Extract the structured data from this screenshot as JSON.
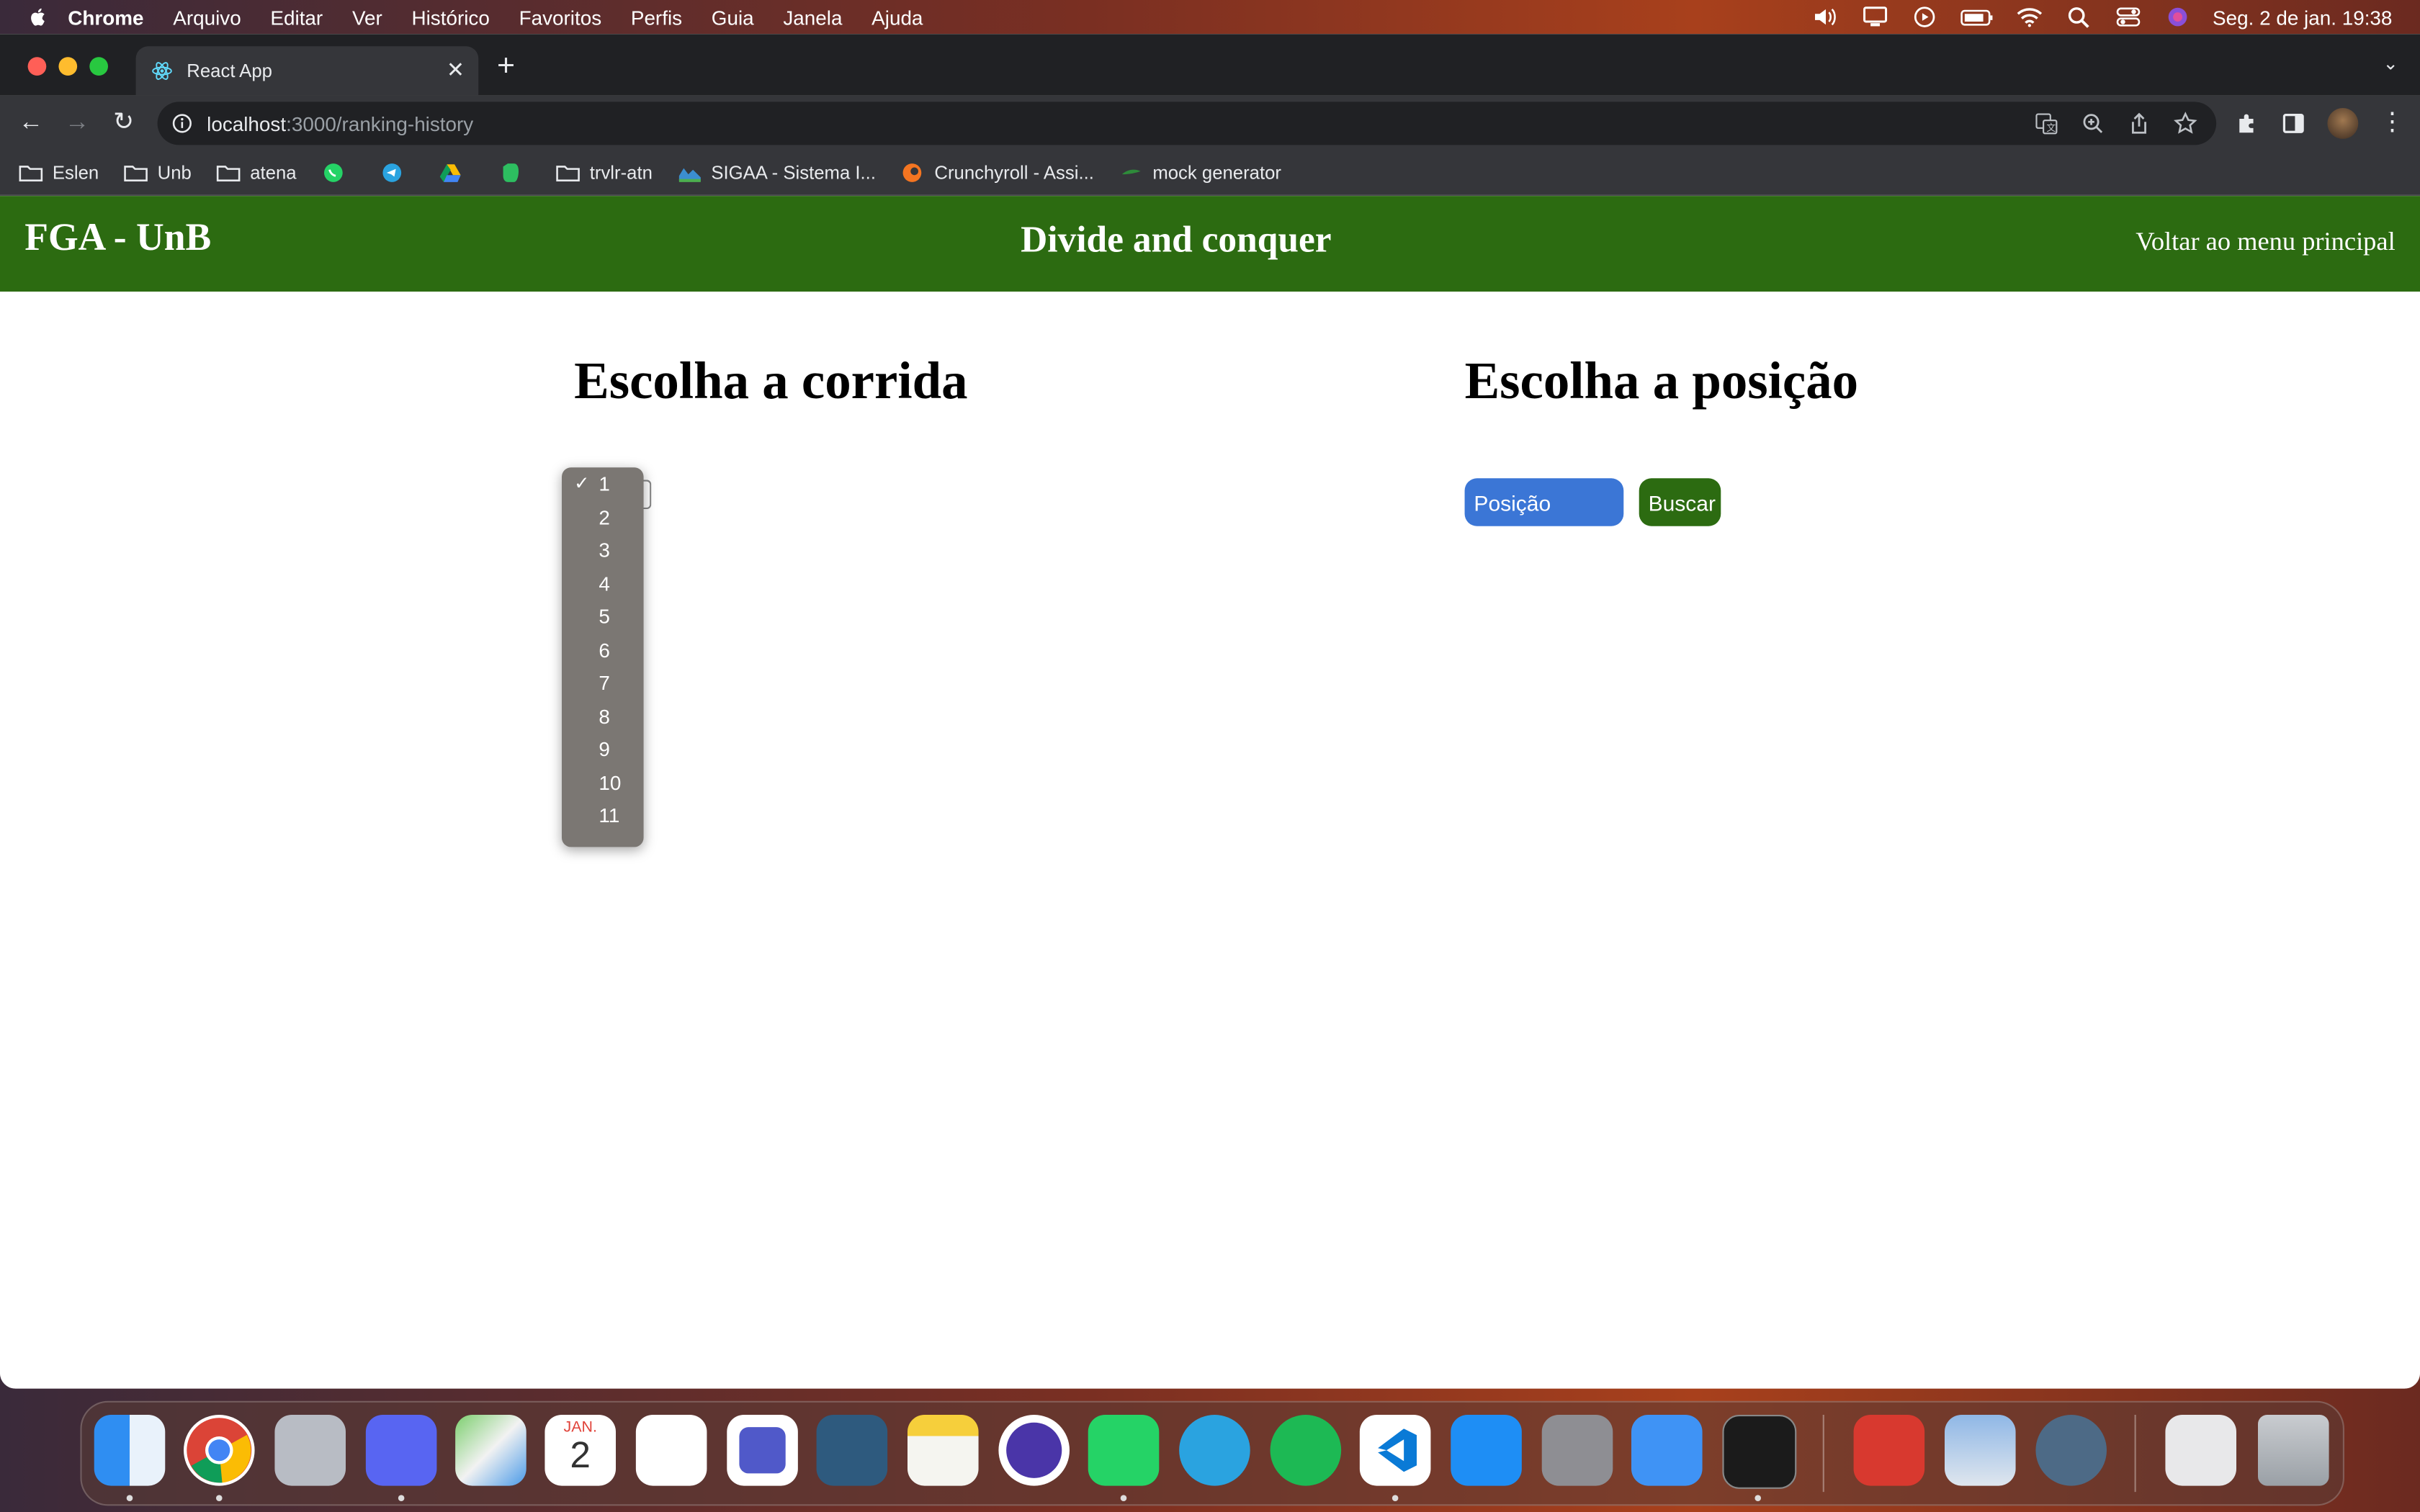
{
  "menubar": {
    "app": "Chrome",
    "items": [
      "Arquivo",
      "Editar",
      "Ver",
      "Histórico",
      "Favoritos",
      "Perfis",
      "Guia",
      "Janela",
      "Ajuda"
    ],
    "clock": "Seg. 2 de jan.  19:38"
  },
  "browser": {
    "tab_title": "React App",
    "url_host": "localhost",
    "url_path": ":3000/ranking-history",
    "bookmarks": [
      {
        "label": "Eslen",
        "icon": "folder-icon"
      },
      {
        "label": "Unb",
        "icon": "folder-icon"
      },
      {
        "label": "atena",
        "icon": "folder-icon"
      },
      {
        "label": "",
        "icon": "whatsapp-icon"
      },
      {
        "label": "",
        "icon": "telegram-icon"
      },
      {
        "label": "",
        "icon": "drive-icon"
      },
      {
        "label": "",
        "icon": "evernote-icon"
      },
      {
        "label": "trvlr-atn",
        "icon": "folder-icon"
      },
      {
        "label": "SIGAA - Sistema I...",
        "icon": "sigaa-icon"
      },
      {
        "label": "Crunchyroll - Assi...",
        "icon": "crunchyroll-icon"
      },
      {
        "label": "mock generator",
        "icon": "leaf-icon"
      }
    ]
  },
  "app": {
    "brand": "FGA - UnB",
    "title": "Divide and conquer",
    "back_link": "Voltar ao menu principal",
    "race_section_title": "Escolha a corrida",
    "race_options": [
      "1",
      "2",
      "3",
      "4",
      "5",
      "6",
      "7",
      "8",
      "9",
      "10",
      "11"
    ],
    "race_selected": "1",
    "position_section_title": "Escolha a posição",
    "position_placeholder": "Posição",
    "search_button": "Buscar"
  },
  "colors": {
    "header_green": "#2c6b11",
    "input_blue": "#3b76d6",
    "dropdown_bg": "#7b7773"
  },
  "dock": [
    "finder-icon",
    "chrome-icon",
    "launchpad-icon",
    "discord-icon",
    "maps-icon",
    "calendar-icon",
    "reminders-icon",
    "teams-icon",
    "mysql-workbench-icon",
    "notes-icon",
    "eclipse-icon",
    "whatsapp-icon",
    "telegram-icon",
    "spotify-icon",
    "vscode-icon",
    "app-store-icon",
    "system-preferences-icon",
    "mail-icon",
    "terminal-icon",
    "photo-booth-icon",
    "preview-icon",
    "quicktime-icon",
    "downloads-icon",
    "trash-icon"
  ],
  "calendar_icon": {
    "month": "JAN.",
    "day": "2"
  }
}
